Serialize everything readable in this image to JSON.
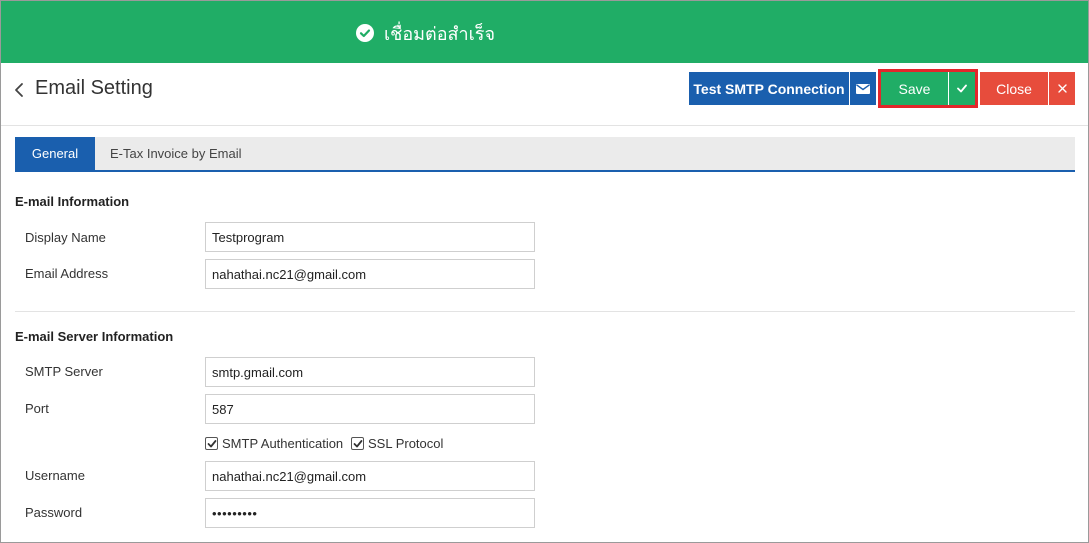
{
  "banner": {
    "message": "เชื่อมต่อสำเร็จ",
    "icon": "check-circle-icon",
    "color": "#20ad66"
  },
  "header": {
    "back_icon": "chevron-left-icon",
    "title": "Email Setting",
    "buttons": {
      "test_smtp": "Test SMTP Connection",
      "test_smtp_icon": "envelope-icon",
      "save": "Save",
      "save_icon": "check-icon",
      "close": "Close",
      "close_icon": "close-icon"
    },
    "colors": {
      "primary": "#1a5fae",
      "success": "#20ad66",
      "danger": "#e74c3c",
      "highlight": "#e3262b"
    }
  },
  "tabs": [
    {
      "label": "General",
      "active": true
    },
    {
      "label": "E-Tax Invoice by Email",
      "active": false
    }
  ],
  "email_info": {
    "title": "E-mail Information",
    "display_name_label": "Display Name",
    "display_name_value": "Testprogram",
    "email_label": "Email Address",
    "email_value": "nahathai.nc21@gmail.com"
  },
  "server_info": {
    "title": "E-mail Server Information",
    "smtp_label": "SMTP Server",
    "smtp_value": "smtp.gmail.com",
    "port_label": "Port",
    "port_value": "587",
    "smtp_auth_label": "SMTP Authentication",
    "smtp_auth_checked": true,
    "ssl_label": "SSL Protocol",
    "ssl_checked": true,
    "username_label": "Username",
    "username_value": "nahathai.nc21@gmail.com",
    "password_label": "Password",
    "password_value": "•••••••••"
  }
}
